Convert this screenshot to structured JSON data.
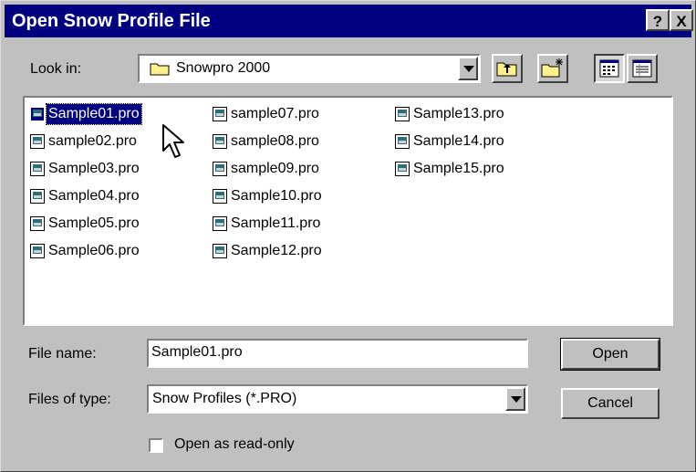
{
  "title": "Open Snow Profile File",
  "title_buttons": {
    "help": "?",
    "close": "X"
  },
  "look_in": {
    "label": "Look in:",
    "value": "Snowpro 2000",
    "icon": "folder-icon"
  },
  "toolbar": [
    "up-one-level-icon",
    "create-new-folder-icon",
    "list-view-icon",
    "details-view-icon"
  ],
  "files": {
    "columns": [
      [
        "Sample01.pro",
        "sample02.pro",
        "Sample03.pro",
        "Sample04.pro",
        "Sample05.pro",
        "Sample06.pro"
      ],
      [
        "sample07.pro",
        "sample08.pro",
        "sample09.pro",
        "Sample10.pro",
        "Sample11.pro",
        "Sample12.pro"
      ],
      [
        "Sample13.pro",
        "Sample14.pro",
        "Sample15.pro"
      ]
    ],
    "selected": "Sample01.pro"
  },
  "file_name": {
    "label": "File name:",
    "value": "Sample01.pro"
  },
  "file_type": {
    "label": "Files of type:",
    "value": "Snow Profiles (*.PRO)"
  },
  "buttons": {
    "open": "Open",
    "cancel": "Cancel"
  },
  "read_only": {
    "label": "Open as read-only",
    "checked": false
  }
}
